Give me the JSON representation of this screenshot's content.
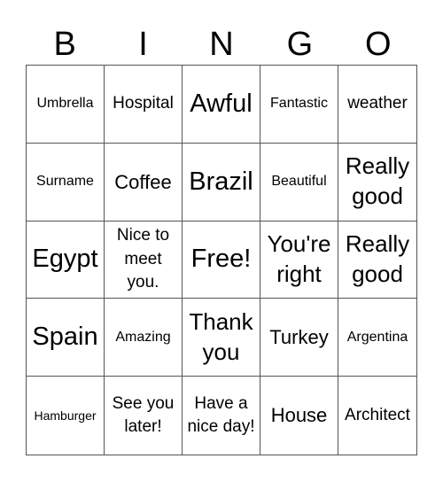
{
  "title_letters": [
    "B",
    "I",
    "N",
    "G",
    "O"
  ],
  "cells": [
    {
      "text": "Umbrella",
      "size": "s2"
    },
    {
      "text": "Hospital",
      "size": "s3"
    },
    {
      "text": "Awful",
      "size": "s6"
    },
    {
      "text": "Fantastic",
      "size": "s2"
    },
    {
      "text": "weather",
      "size": "s3"
    },
    {
      "text": "Surname",
      "size": "s2"
    },
    {
      "text": "Coffee",
      "size": "s4"
    },
    {
      "text": "Brazil",
      "size": "s6"
    },
    {
      "text": "Beautiful",
      "size": "s2"
    },
    {
      "text": "Really good",
      "size": "s5"
    },
    {
      "text": "Egypt",
      "size": "s6"
    },
    {
      "text": "Nice to meet you.",
      "size": "s3"
    },
    {
      "text": "Free!",
      "size": "s6"
    },
    {
      "text": "You're right",
      "size": "s5"
    },
    {
      "text": "Really good",
      "size": "s5"
    },
    {
      "text": "Spain",
      "size": "s6"
    },
    {
      "text": "Amazing",
      "size": "s2"
    },
    {
      "text": "Thank you",
      "size": "s5"
    },
    {
      "text": "Turkey",
      "size": "s4"
    },
    {
      "text": "Argentina",
      "size": "s2"
    },
    {
      "text": "Hamburger",
      "size": "s1"
    },
    {
      "text": "See you later!",
      "size": "s3"
    },
    {
      "text": "Have a nice day!",
      "size": "s3"
    },
    {
      "text": "House",
      "size": "s4"
    },
    {
      "text": "Architect",
      "size": "s3"
    }
  ]
}
